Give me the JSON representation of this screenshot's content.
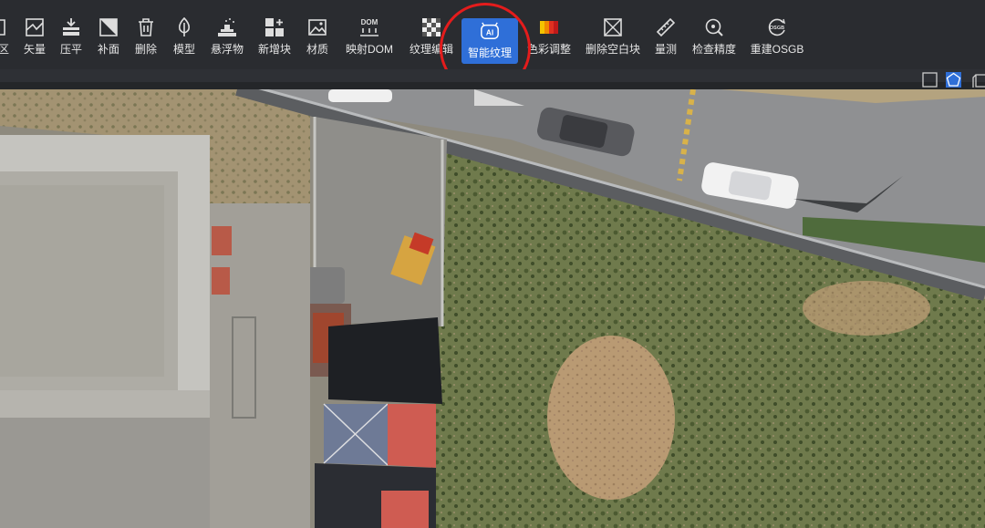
{
  "toolbar": {
    "items": [
      {
        "id": "area",
        "label": "区",
        "icon": "area-icon"
      },
      {
        "id": "vector",
        "label": "矢量",
        "icon": "vector-icon"
      },
      {
        "id": "flatten",
        "label": "压平",
        "icon": "flatten-icon"
      },
      {
        "id": "patch",
        "label": "补面",
        "icon": "patch-icon"
      },
      {
        "id": "delete",
        "label": "删除",
        "icon": "trash-icon"
      },
      {
        "id": "model",
        "label": "模型",
        "icon": "leaf-icon"
      },
      {
        "id": "floating",
        "label": "悬浮物",
        "icon": "floating-icon"
      },
      {
        "id": "new-block",
        "label": "新增块",
        "icon": "new-block-icon"
      },
      {
        "id": "material",
        "label": "材质",
        "icon": "material-icon"
      },
      {
        "id": "map-dom",
        "label": "映射DOM",
        "icon": "dom-icon",
        "icon_text": "DOM"
      },
      {
        "id": "texture-edit",
        "label": "纹理编辑",
        "icon": "checker-icon"
      },
      {
        "id": "ai-texture",
        "label": "智能纹理",
        "icon": "ai-icon",
        "icon_text": "AI",
        "active": true
      },
      {
        "id": "color-adjust",
        "label": "色彩调整",
        "icon": "color-icon"
      },
      {
        "id": "delete-empty",
        "label": "删除空白块",
        "icon": "empty-block-icon"
      },
      {
        "id": "measure",
        "label": "量测",
        "icon": "ruler-icon"
      },
      {
        "id": "check-accuracy",
        "label": "检查精度",
        "icon": "accuracy-icon"
      },
      {
        "id": "rebuild-osgb",
        "label": "重建OSGB",
        "icon": "osgb-icon",
        "icon_text": "OSGB"
      }
    ]
  },
  "colors": {
    "toolbar_bg": "#2a2c30",
    "active_blue": "#2f6fd8",
    "highlight_red": "#e41c1c"
  },
  "shape_tools": [
    {
      "icon": "square-icon"
    },
    {
      "icon": "pentagon-icon",
      "active": true
    },
    {
      "icon": "cube-icon"
    }
  ]
}
